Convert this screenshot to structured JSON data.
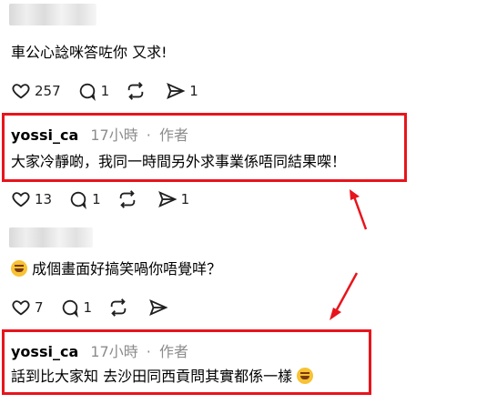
{
  "post1": {
    "text": "車公心諗咪答咗你 又求!",
    "likes": "257",
    "replies": "1",
    "shares": "1"
  },
  "reply1": {
    "username": "yossi_ca",
    "time": "17小時",
    "separator": "·",
    "role": "作者",
    "text": "大家冷靜啲，我同一時間另外求事業係唔同結果㗎！",
    "likes": "13",
    "replies": "1",
    "shares": "1"
  },
  "post2": {
    "text": "成個畫面好搞笑喎你唔覺咩？",
    "likes": "7",
    "replies": "1"
  },
  "reply2": {
    "username": "yossi_ca",
    "time": "17小時",
    "separator": "·",
    "role": "作者",
    "text": "話到比大家知 去沙田同西貢問其實都係一樣"
  },
  "colors": {
    "highlight": "#e8141c",
    "meta_gray": "#8c8c8c"
  },
  "icons": [
    "heart-icon",
    "comment-icon",
    "repost-icon",
    "send-icon",
    "laughing-emoji-icon",
    "red-arrow"
  ]
}
